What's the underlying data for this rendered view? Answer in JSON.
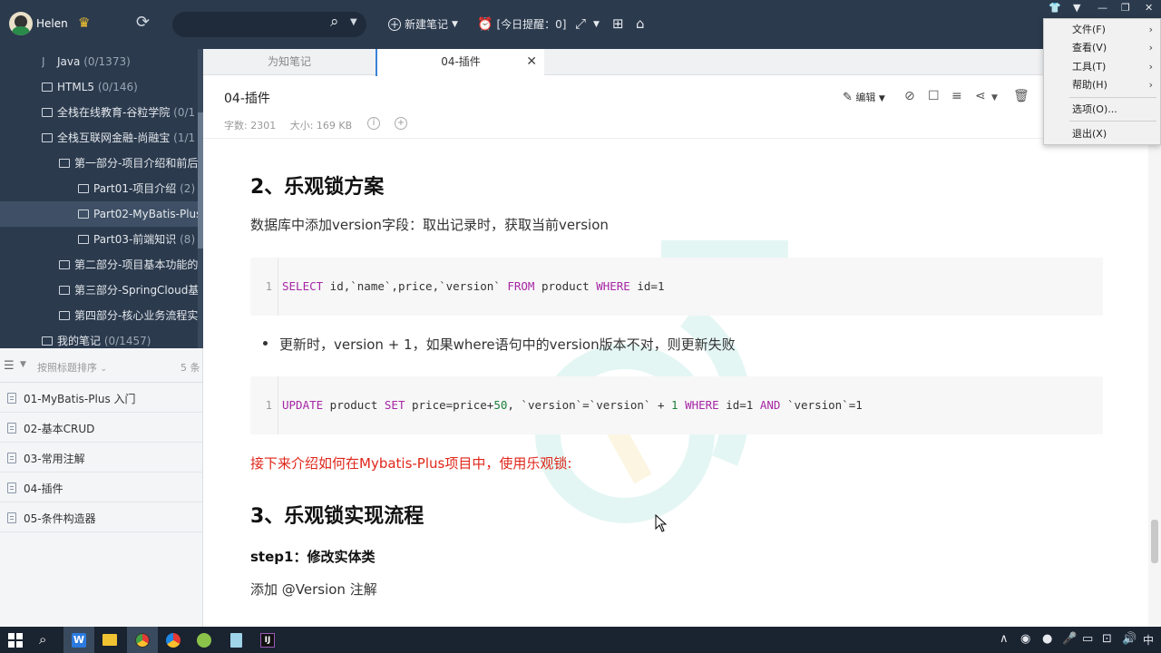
{
  "topbar": {
    "username": "Helen",
    "new_note": "新建笔记",
    "reminder": "[今日提醒：0]"
  },
  "menu": {
    "items": [
      {
        "label": "文件(F)",
        "arrow": "›"
      },
      {
        "label": "查看(V)",
        "arrow": "›"
      },
      {
        "label": "工具(T)",
        "arrow": "›"
      },
      {
        "label": "帮助(H)",
        "arrow": "›"
      },
      {
        "label": "选项(O)..."
      },
      {
        "label": "退出(X)"
      }
    ]
  },
  "tree": {
    "items": [
      {
        "label": "Java",
        "count": "(0/1373)"
      },
      {
        "label": "HTML5",
        "count": "(0/146)"
      },
      {
        "label": "全栈在线教育-谷粒学院",
        "count": "(0/1"
      },
      {
        "label": "全栈互联网金融-尚融宝",
        "count": "(1/1"
      },
      {
        "label": "第一部分-项目介绍和前后",
        "count": ""
      },
      {
        "label": "Part01-项目介绍",
        "count": "(2)"
      },
      {
        "label": "Part02-MyBatis-Plus",
        "count": ""
      },
      {
        "label": "Part03-前端知识",
        "count": "(8)"
      },
      {
        "label": "第二部分-项目基本功能的",
        "count": ""
      },
      {
        "label": "第三部分-SpringCloud基",
        "count": ""
      },
      {
        "label": "第四部分-核心业务流程实",
        "count": ""
      },
      {
        "label": "我的笔记",
        "count": "(0/1457)"
      }
    ]
  },
  "list": {
    "sort_label": "按照标题排序",
    "count": "5 条",
    "notes": [
      {
        "title": "01-MyBatis-Plus 入门"
      },
      {
        "title": "02-基本CRUD"
      },
      {
        "title": "03-常用注解"
      },
      {
        "title": "04-插件"
      },
      {
        "title": "05-条件构造器"
      }
    ]
  },
  "tabs": [
    {
      "label": "为知笔记"
    },
    {
      "label": "04-插件"
    }
  ],
  "note": {
    "title": "04-插件",
    "word_count": "字数: 2301",
    "size": "大小: 169 KB",
    "edit_label": "编辑"
  },
  "content": {
    "h2_1": "2、乐观锁方案",
    "p1": "数据库中添加version字段：取出记录时，获取当前version",
    "code1": {
      "line_no": "1",
      "kw_select": "SELECT",
      "part1": " id,`name`,price,`version` ",
      "kw_from": "FROM",
      "part2": " product ",
      "kw_where": "WHERE",
      "part3": " id=1"
    },
    "bullet1": "更新时，version + 1，如果where语句中的version版本不对，则更新失败",
    "code2": {
      "line_no": "1",
      "kw_update": "UPDATE",
      "part1": " product ",
      "kw_set": "SET",
      "part2": " price=price+",
      "num1": "50",
      "part3": ", `version`=`version` + ",
      "num2": "1",
      "part4": " ",
      "kw_where": "WHERE",
      "part5": " id=1 ",
      "kw_and": "AND",
      "part6": " `version`=1"
    },
    "red_line": "接下来介绍如何在Mybatis-Plus项目中，使用乐观锁:",
    "h2_2": "3、乐观锁实现流程",
    "h4_1": "step1：修改实体类",
    "p2": "添加 @Version 注解"
  },
  "taskbar": {
    "ime": "中"
  },
  "colors": {
    "sidebar_bg": "#2b3a4d",
    "accent_blue": "#3b82d6",
    "keyword_purple": "#a626a4",
    "red_text": "#e0261a",
    "watermark": "#2fb7a0"
  }
}
